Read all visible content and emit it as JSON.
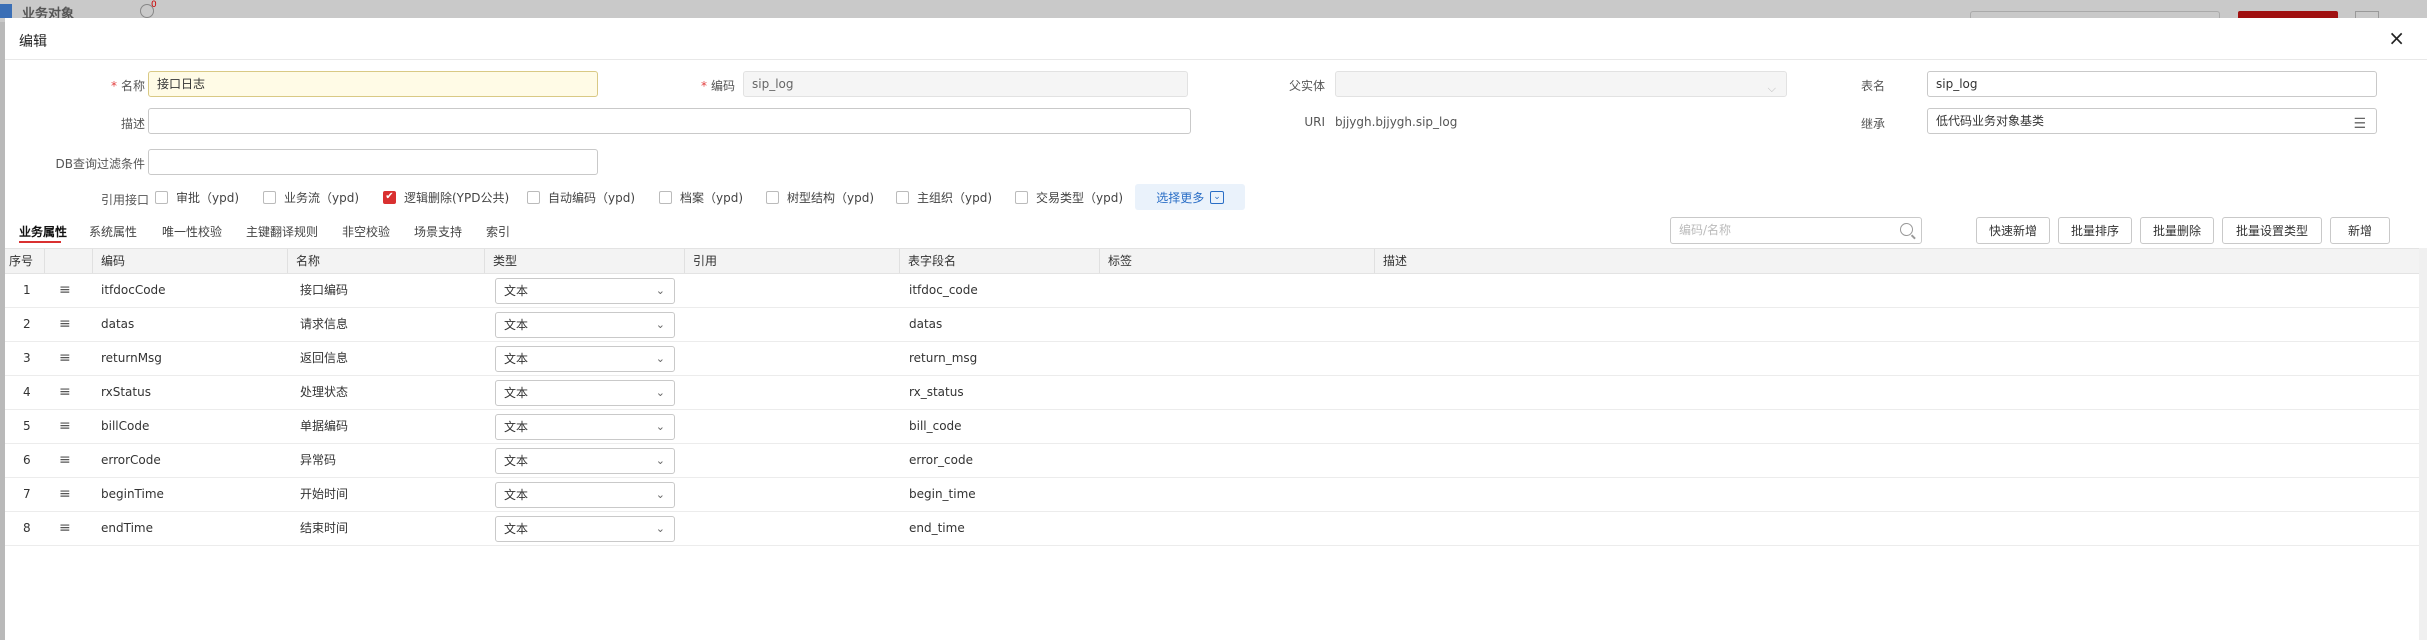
{
  "background": {
    "title": "业务对象",
    "badge": "0"
  },
  "dialog": {
    "title": "编辑",
    "close": "×"
  },
  "form": {
    "name": {
      "label": "名称",
      "value": "接口日志"
    },
    "code": {
      "label": "编码",
      "value": "sip_log"
    },
    "parent": {
      "label": "父实体",
      "value": ""
    },
    "table_name": {
      "label": "表名",
      "value": "sip_log"
    },
    "description": {
      "label": "描述",
      "value": ""
    },
    "uri": {
      "label": "URI",
      "value": "bjjygh.bjjygh.sip_log"
    },
    "inherit": {
      "label": "继承",
      "value": "低代码业务对象基类"
    },
    "db_filter": {
      "label": "DB查询过滤条件",
      "value": ""
    }
  },
  "interfaces": {
    "label": "引用接口",
    "items": [
      {
        "label": "审批（ypd)",
        "checked": false
      },
      {
        "label": "业务流（ypd)",
        "checked": false
      },
      {
        "label": "逻辑删除(YPD公共)",
        "checked": true
      },
      {
        "label": "自动编码（ypd)",
        "checked": false
      },
      {
        "label": "档案（ypd)",
        "checked": false
      },
      {
        "label": "树型结构（ypd)",
        "checked": false
      },
      {
        "label": "主组织（ypd)",
        "checked": false
      },
      {
        "label": "交易类型（ypd)",
        "checked": false
      }
    ],
    "more": "选择更多"
  },
  "tabs": [
    "业务属性",
    "系统属性",
    "唯一性校验",
    "主键翻译规则",
    "非空校验",
    "场景支持",
    "索引"
  ],
  "toolbar": {
    "search_placeholder": "编码/名称",
    "buttons": [
      "快速新增",
      "批量排序",
      "批量删除",
      "批量设置类型",
      "新增"
    ]
  },
  "table": {
    "headers": [
      "序号",
      "编码",
      "名称",
      "类型",
      "引用",
      "表字段名",
      "标签",
      "描述"
    ],
    "rows": [
      {
        "no": "1",
        "code": "itfdocCode",
        "name": "接口编码",
        "type": "文本",
        "field": "itfdoc_code"
      },
      {
        "no": "2",
        "code": "datas",
        "name": "请求信息",
        "type": "文本",
        "field": "datas"
      },
      {
        "no": "3",
        "code": "returnMsg",
        "name": "返回信息",
        "type": "文本",
        "field": "return_msg"
      },
      {
        "no": "4",
        "code": "rxStatus",
        "name": "处理状态",
        "type": "文本",
        "field": "rx_status"
      },
      {
        "no": "5",
        "code": "billCode",
        "name": "单据编码",
        "type": "文本",
        "field": "bill_code"
      },
      {
        "no": "6",
        "code": "errorCode",
        "name": "异常码",
        "type": "文本",
        "field": "error_code"
      },
      {
        "no": "7",
        "code": "beginTime",
        "name": "开始时间",
        "type": "文本",
        "field": "begin_time"
      },
      {
        "no": "8",
        "code": "endTime",
        "name": "结束时间",
        "type": "文本",
        "field": "end_time"
      }
    ]
  },
  "colors": {
    "accent": "#d93030",
    "link": "#2a6ec6",
    "required": "#e34040"
  }
}
